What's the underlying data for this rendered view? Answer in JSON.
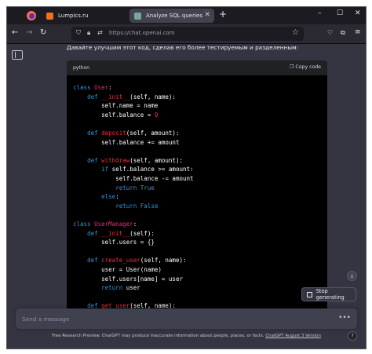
{
  "browser": {
    "tabs": [
      {
        "title": "Lumpics.ru",
        "favicon_color": "#f37021"
      },
      {
        "title": "Analyze SQL queries",
        "favicon_color": "#74aa9c"
      }
    ],
    "url": "https://chat.openai.com",
    "new_tab_label": "+",
    "window_controls": {
      "minimize": "–",
      "maximize": "☐",
      "close": "✕"
    }
  },
  "chat": {
    "prompt": "Давайте улучшим этот код, сделав его более тестируемым и разделенным:",
    "code_block": {
      "language": "python",
      "copy_label": "Copy code",
      "lines": [
        "class User:",
        "    def __init__(self, name):",
        "        self.name = name",
        "        self.balance = 0",
        "",
        "    def deposit(self, amount):",
        "        self.balance += amount",
        "",
        "    def withdraw(self, amount):",
        "        if self.balance >= amount:",
        "            self.balance -= amount",
        "            return True",
        "        else:",
        "            return False",
        "",
        "class UserManager:",
        "    def __init__(self):",
        "        self.users = {}",
        "",
        "    def create_user(self, name):",
        "        user = User(name)",
        "        self.users[name] = user",
        "        return user",
        "",
        "    def get_user(self, name):"
      ]
    },
    "stop_label": "Stop generating",
    "input_placeholder": "Send a message",
    "footer_text": "Free Research Preview. ChatGPT may produce inaccurate information about people, places, or facts. ",
    "footer_link": "ChatGPT August 3 Version",
    "help_label": "?"
  },
  "colors": {
    "keyword": "#2e95d3",
    "class_name": "#df3079",
    "function_name": "#f22c3d"
  }
}
